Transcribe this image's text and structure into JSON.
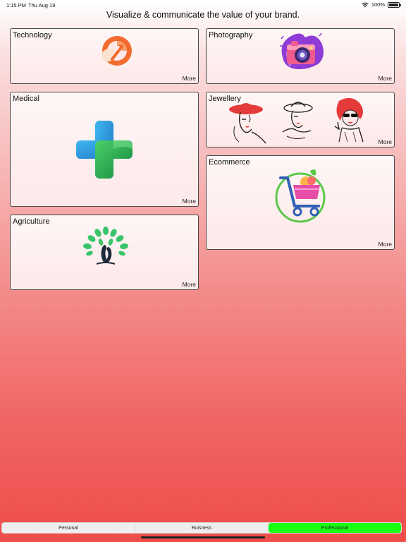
{
  "status_bar": {
    "time": "1:15 PM",
    "date": "Thu Aug 19",
    "battery": "100%",
    "icons": [
      "wifi-icon",
      "battery-icon"
    ]
  },
  "headline": "Visualize & communicate the value of your brand.",
  "cards": [
    {
      "id": "technology",
      "title": "Technology",
      "more": "More",
      "icon": "technology-logo-icon"
    },
    {
      "id": "photography",
      "title": "Photography",
      "more": "More",
      "icon": "camera-logo-icon"
    },
    {
      "id": "medical",
      "title": "Medical",
      "more": "More",
      "icon": "medical-cross-icon"
    },
    {
      "id": "jewellery",
      "title": "Jewellery",
      "more": "More",
      "icon": "lady-hat-icon"
    },
    {
      "id": "ecommerce",
      "title": "Ecommerce",
      "more": "More",
      "icon": "shopping-cart-icon"
    },
    {
      "id": "agriculture",
      "title": "Agriculture",
      "more": "More",
      "icon": "tree-leaf-icon"
    }
  ],
  "tabs": [
    {
      "label": "Personal",
      "active": false
    },
    {
      "label": "Buisness",
      "active": false
    },
    {
      "label": "Professional",
      "active": true
    }
  ],
  "colors": {
    "active_tab": "#19ff14",
    "gradient_top": "#ffffff",
    "gradient_bottom": "#ee4d4a"
  }
}
